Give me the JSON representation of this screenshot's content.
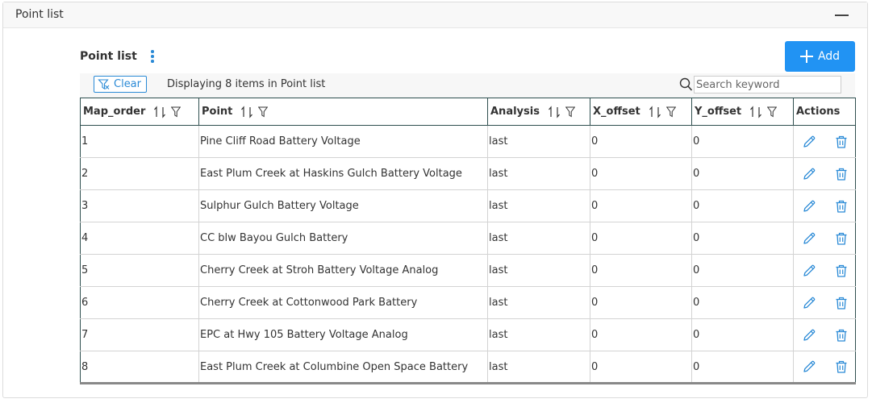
{
  "panel": {
    "title": "Point list"
  },
  "list": {
    "title": "Point list",
    "add_label": "Add",
    "clear_label": "Clear",
    "displaying_text": "Displaying 8 items in Point list",
    "search_placeholder": "Search keyword"
  },
  "table": {
    "headers": {
      "map_order": "Map_order",
      "point": "Point",
      "analysis": "Analysis",
      "x_offset": "X_offset",
      "y_offset": "Y_offset",
      "actions": "Actions"
    },
    "rows": [
      {
        "map_order": "1",
        "point": "Pine Cliff Road Battery Voltage",
        "analysis": "last",
        "x_offset": "0",
        "y_offset": "0"
      },
      {
        "map_order": "2",
        "point": "East Plum Creek at Haskins Gulch Battery Voltage",
        "analysis": "last",
        "x_offset": "0",
        "y_offset": "0"
      },
      {
        "map_order": "3",
        "point": "Sulphur Gulch Battery Voltage",
        "analysis": "last",
        "x_offset": "0",
        "y_offset": "0"
      },
      {
        "map_order": "4",
        "point": "CC blw Bayou Gulch Battery",
        "analysis": "last",
        "x_offset": "0",
        "y_offset": "0"
      },
      {
        "map_order": "5",
        "point": "Cherry Creek at Stroh Battery Voltage Analog",
        "analysis": "last",
        "x_offset": "0",
        "y_offset": "0"
      },
      {
        "map_order": "6",
        "point": "Cherry Creek at Cottonwood Park Battery",
        "analysis": "last",
        "x_offset": "0",
        "y_offset": "0"
      },
      {
        "map_order": "7",
        "point": "EPC at Hwy 105 Battery Voltage Analog",
        "analysis": "last",
        "x_offset": "0",
        "y_offset": "0"
      },
      {
        "map_order": "8",
        "point": "East Plum Creek at Columbine Open Space Battery",
        "analysis": "last",
        "x_offset": "0",
        "y_offset": "0"
      }
    ]
  },
  "colors": {
    "accent": "#2193f3",
    "icon_blue": "#2a8ad6"
  }
}
